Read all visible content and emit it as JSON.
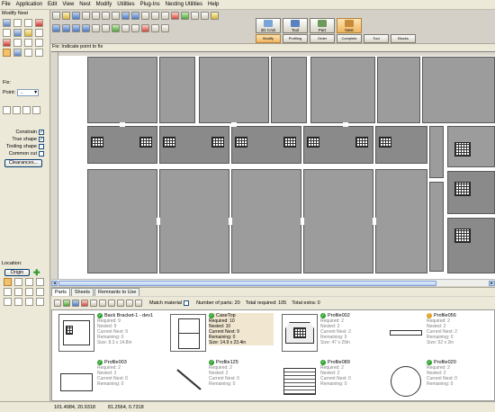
{
  "menu": [
    "File",
    "Application",
    "Edit",
    "View",
    "Nest",
    "Modify",
    "Utilities",
    "Plug-Ins",
    "Nesting Utilities",
    "Help"
  ],
  "left_panel": {
    "title": "Modify Nest",
    "fix_label": "Fix:",
    "point_label": "Point:",
    "point_value": "→",
    "checks": [
      {
        "label": "Constrain",
        "checked": true
      },
      {
        "label": "True shape",
        "checked": true
      },
      {
        "label": "Tooling shape",
        "checked": false
      },
      {
        "label": "Common cut",
        "checked": false
      }
    ],
    "clearances_button": "Clearances...",
    "location_label": "Location:",
    "origin_button": "Origin"
  },
  "ribbon": {
    "buttons": [
      {
        "label": "2D CAD",
        "color": "#7aa3d8",
        "active": false
      },
      {
        "label": "Tool",
        "color": "#5a82c2",
        "active": false
      },
      {
        "label": "Part",
        "color": "#6b9a5a",
        "active": false
      },
      {
        "label": "Nest",
        "color": "#c88b3a",
        "active": true
      }
    ],
    "buttons2": [
      {
        "label": "Modify",
        "color": "#c8322b",
        "active": true
      },
      {
        "label": "Profiling",
        "color": "#b84a8a",
        "active": false
      },
      {
        "label": "Order",
        "color": "#4a78c8",
        "active": false
      },
      {
        "label": "Complete",
        "color": "#3a9a3a",
        "active": false
      },
      {
        "label": "Tool",
        "color": "#8a3aa8",
        "active": false
      },
      {
        "label": "Blocks",
        "color": "#5a82c2",
        "active": false
      }
    ]
  },
  "prompt": "Fix: Indicate point to fix",
  "parts_tabs": [
    "Parts",
    "Sheets",
    "Remnants to Use"
  ],
  "parts_toolbar": {
    "match_material": "Match material",
    "num_parts": "Number of parts: 20",
    "total_required": "Total required: 105",
    "total_extra": "Total extra: 0"
  },
  "parts": [
    {
      "name": "Back Bracket-1 - dev1",
      "required": "Required: 9",
      "nested": "Nested: 9",
      "current": "Current Nest: 9",
      "remaining": "Remaining: 0",
      "size": "Size: 8.3 x 14.8in",
      "status": "ok"
    },
    {
      "name": "CaseTop",
      "required": "Required: 10",
      "nested": "Nested: 10",
      "current": "Current Nest: 9",
      "remaining": "Remaining: 0",
      "size": "Size: 14.9 x 23.4in",
      "status": "ok"
    },
    {
      "name": "Profile002",
      "required": "Required: 2",
      "nested": "Nested: 2",
      "current": "Current Nest: 2",
      "remaining": "Remaining: 0",
      "size": "Size: 47 x 29in",
      "status": "ok"
    },
    {
      "name": "Profile056",
      "required": "Required: 2",
      "nested": "Nested: 2",
      "current": "Current Nest: 2",
      "remaining": "Remaining: 0",
      "size": "Size: 52 x 2in",
      "status": "warn"
    },
    {
      "name": "Profile003",
      "required": "Required: 2",
      "nested": "Nested: 2",
      "current": "Current Nest: 0",
      "remaining": "Remaining: 0",
      "size": "",
      "status": "ok"
    },
    {
      "name": "Profile125",
      "required": "Required: 2",
      "nested": "Nested: 2",
      "current": "Current Nest: 0",
      "remaining": "Remaining: 0",
      "size": "",
      "status": "ok"
    },
    {
      "name": "Profile089",
      "required": "Required: 2",
      "nested": "Nested: 2",
      "current": "Current Nest: 0",
      "remaining": "Remaining: 0",
      "size": "",
      "status": "ok"
    },
    {
      "name": "Profile020",
      "required": "Required: 2",
      "nested": "Nested: 2",
      "current": "Current Nest: 0",
      "remaining": "Remaining: 0",
      "size": "",
      "status": "ok"
    }
  ],
  "status_bar": {
    "coord1": "101.4984, 20.9318",
    "coord2": "81.2564, 0.7318"
  },
  "colors": {
    "part_fill": "#9c9c9c",
    "selected": "#f2c26b",
    "ok": "#2ea02e"
  }
}
